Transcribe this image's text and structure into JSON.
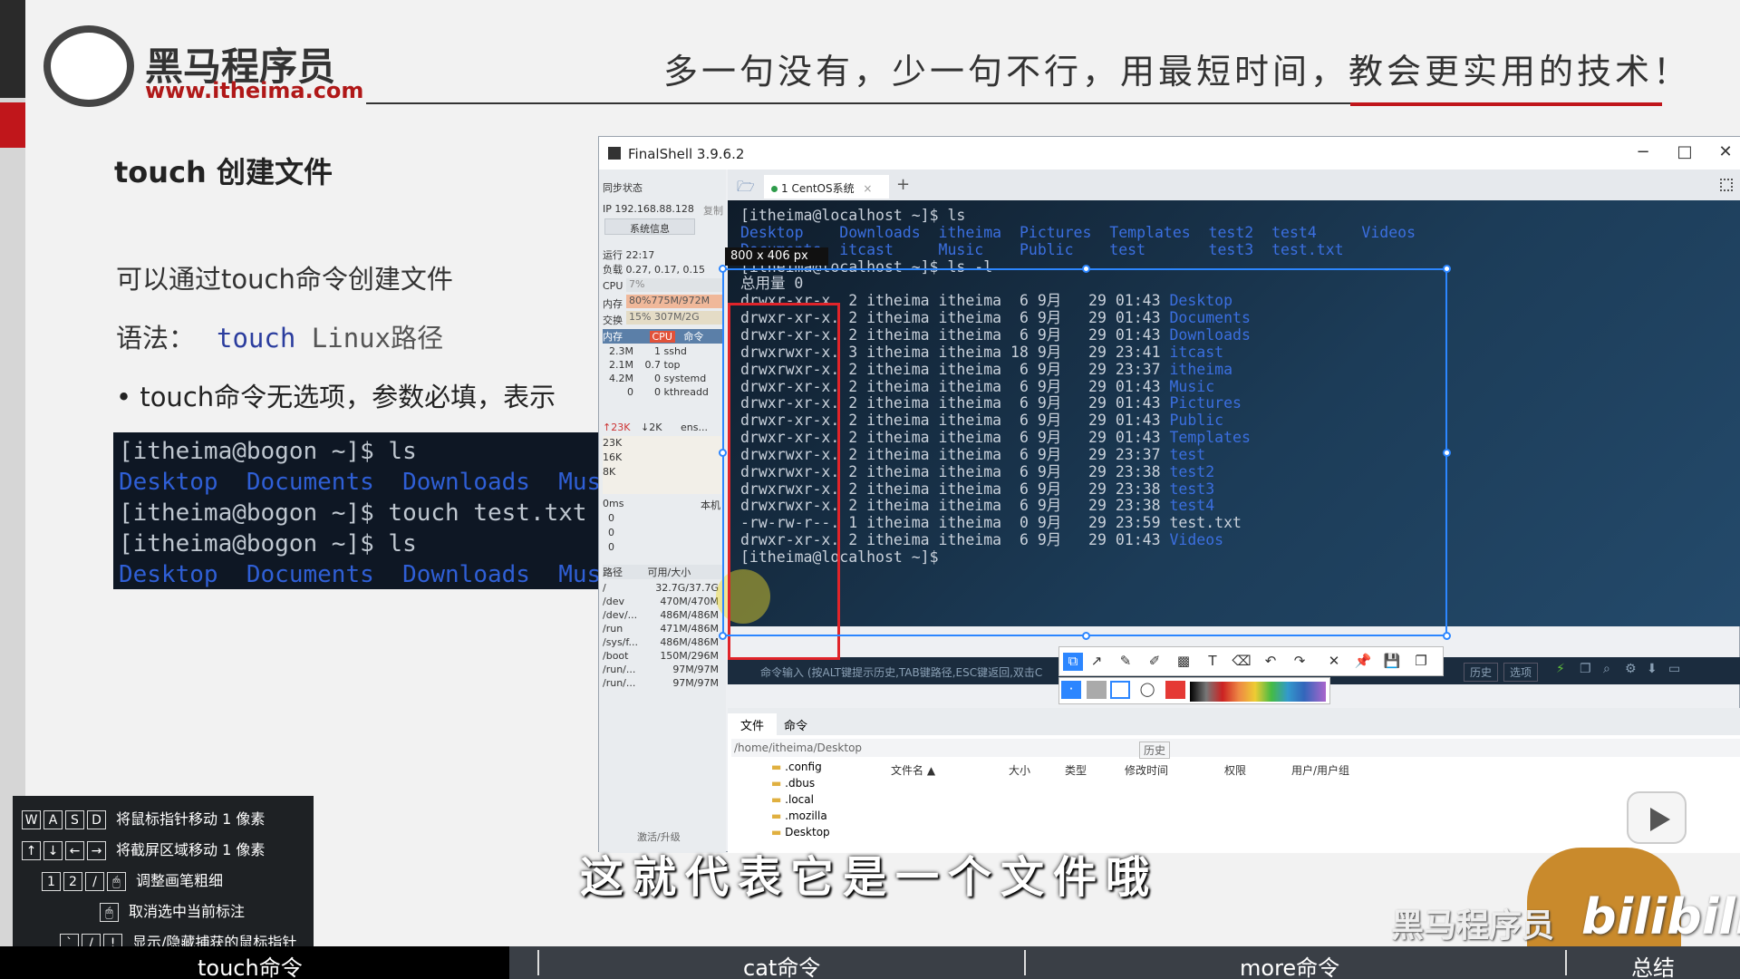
{
  "slide": {
    "logo_name": "黑马程序员",
    "logo_url": "www.itheima.com",
    "slogan": "多一句没有，少一句不行，用最短时间，教会更实用的技术！",
    "title": "touch 创建文件",
    "p1": "可以通过touch命令创建文件",
    "p2_label": "语法：",
    "p2_code": "touch",
    "p2_arg": " Linux路径",
    "p3": "•   touch命令无选项，参数必填，表示",
    "terminal": [
      {
        "text": "[itheima@bogon ~]$ ls",
        "type": "plain"
      },
      {
        "text": "Desktop  Documents  Downloads  Musi",
        "type": "blue"
      },
      {
        "text": "[itheima@bogon ~]$ touch test.txt",
        "type": "plain"
      },
      {
        "text": "[itheima@bogon ~]$ ls",
        "type": "plain"
      },
      {
        "text": "Desktop  Documents  Downloads  Musi",
        "type": "blue"
      }
    ]
  },
  "window": {
    "title": "FinalShell 3.9.6.2",
    "controls": {
      "minimize": "−",
      "maximize": "□",
      "close": "✕"
    },
    "side": {
      "sync": "同步状态",
      "ip": "IP 192.168.88.128",
      "copy": "复制",
      "sysinfo": "系统信息",
      "uptime": "运行 22:17",
      "load": "负载 0.27, 0.17, 0.15",
      "cpu": "CPU",
      "cpu_val": "7%",
      "mem": "内存",
      "mem_val": "80%775M/972M",
      "swap": "交换",
      "swap_val": "15%    307M/2G",
      "proc_header": [
        "内存",
        "CPU",
        "命令"
      ],
      "procs": [
        {
          "mem": "2.3M",
          "cpu": "1",
          "cmd": "sshd"
        },
        {
          "mem": "2.1M",
          "cpu": "0.7",
          "cmd": "top"
        },
        {
          "mem": "4.2M",
          "cpu": "0",
          "cmd": "systemd"
        },
        {
          "mem": "0",
          "cpu": "0",
          "cmd": "kthreadd"
        }
      ],
      "net_up": "23K",
      "net_down": "2K",
      "net_if": "ens...",
      "net_scale": [
        "23K",
        "16K",
        "8K"
      ],
      "latency_label": "0ms",
      "latency_host": "本机",
      "latency_vals": [
        "0",
        "0",
        "0"
      ],
      "disk_header": [
        "路径",
        "可用/大小"
      ],
      "disks": [
        {
          "path": "/",
          "size": "32.7G/37.7G"
        },
        {
          "path": "/dev",
          "size": "470M/470M"
        },
        {
          "path": "/dev/...",
          "size": "486M/486M"
        },
        {
          "path": "/run",
          "size": "471M/486M"
        },
        {
          "path": "/sys/f...",
          "size": "486M/486M"
        },
        {
          "path": "/boot",
          "size": "150M/296M"
        },
        {
          "path": "/run/...",
          "size": "97M/97M"
        },
        {
          "path": "/run/...",
          "size": "97M/97M"
        }
      ],
      "activate": "激活/升级"
    },
    "tab_label": "1 CentOS系统",
    "tab_close": "×",
    "tab_add": "+",
    "terminal_lines": [
      {
        "pre": "[itheima@localhost ~]$ ls",
        "name": "",
        "dir": false
      },
      {
        "pre": "Desktop    Downloads  itheima  Pictures  Templates  test2  test4     Videos",
        "name": "",
        "dir": true
      },
      {
        "pre": "Documents  itcast     Music    Public    test       test3  test.txt",
        "name": "",
        "dir": true
      },
      {
        "pre": "[itheima@localhost ~]$ ls -l",
        "name": "",
        "dir": false
      },
      {
        "pre": "总用量 0",
        "name": "",
        "dir": false
      },
      {
        "pre": "drwxr-xr-x. 2 itheima itheima  6 9月   29 01:43 ",
        "name": "Desktop",
        "dir": true
      },
      {
        "pre": "drwxr-xr-x. 2 itheima itheima  6 9月   29 01:43 ",
        "name": "Documents",
        "dir": true
      },
      {
        "pre": "drwxr-xr-x. 2 itheima itheima  6 9月   29 01:43 ",
        "name": "Downloads",
        "dir": true
      },
      {
        "pre": "drwxrwxr-x. 3 itheima itheima 18 9月   29 23:41 ",
        "name": "itcast",
        "dir": true
      },
      {
        "pre": "drwxrwxr-x. 2 itheima itheima  6 9月   29 23:37 ",
        "name": "itheima",
        "dir": true
      },
      {
        "pre": "drwxr-xr-x. 2 itheima itheima  6 9月   29 01:43 ",
        "name": "Music",
        "dir": true
      },
      {
        "pre": "drwxr-xr-x. 2 itheima itheima  6 9月   29 01:43 ",
        "name": "Pictures",
        "dir": true
      },
      {
        "pre": "drwxr-xr-x. 2 itheima itheima  6 9月   29 01:43 ",
        "name": "Public",
        "dir": true
      },
      {
        "pre": "drwxr-xr-x. 2 itheima itheima  6 9月   29 01:43 ",
        "name": "Templates",
        "dir": true
      },
      {
        "pre": "drwxrwxr-x. 2 itheima itheima  6 9月   29 23:37 ",
        "name": "test",
        "dir": true
      },
      {
        "pre": "drwxrwxr-x. 2 itheima itheima  6 9月   29 23:38 ",
        "name": "test2",
        "dir": true
      },
      {
        "pre": "drwxrwxr-x. 2 itheima itheima  6 9月   29 23:38 ",
        "name": "test3",
        "dir": true
      },
      {
        "pre": "drwxrwxr-x. 2 itheima itheima  6 9月   29 23:38 ",
        "name": "test4",
        "dir": true
      },
      {
        "pre": "-rw-rw-r--. 1 itheima itheima  0 9月   29 23:59 ",
        "name": "test.txt",
        "dir": false
      },
      {
        "pre": "drwxr-xr-x. 2 itheima itheima  6 9月   29 01:43 ",
        "name": "Videos",
        "dir": true
      },
      {
        "pre": "[itheima@localhost ~]$ ",
        "name": "",
        "dir": false
      }
    ],
    "size_tag": "800 x 406  px",
    "cmd_hint": "命令输入 (按ALT键提示历史,TAB键路径,ESC键返回,双击C",
    "history_btn": "历史",
    "options_btn": "选项",
    "bottom_tabs": [
      "文件",
      "命令"
    ],
    "path": "/home/itheima/Desktop",
    "path_history": "历史",
    "tree": [
      ".config",
      ".dbus",
      ".local",
      ".mozilla",
      "Desktop"
    ],
    "file_cols": [
      "文件名 ▲",
      "大小",
      "类型",
      "修改时间",
      "权限",
      "用户/用户组"
    ]
  },
  "keys": [
    {
      "keys": [
        "W",
        "A",
        "S",
        "D"
      ],
      "text": "将鼠标指针移动 1 像素"
    },
    {
      "keys": [
        "↑",
        "↓",
        "←",
        "→"
      ],
      "text": "将截屏区域移动 1 像素"
    },
    {
      "keys": [
        "1",
        "2",
        "/",
        "🖱"
      ],
      "text": "调整画笔粗细"
    },
    {
      "keys": [
        "🖱"
      ],
      "text": "取消选中当前标注"
    },
    {
      "keys": [
        "`",
        "/",
        "!"
      ],
      "text": "显示/隐藏捕获的鼠标指针"
    }
  ],
  "subtitle": "这就代表它是一个文件哦",
  "watermark": "黑马程序员",
  "bili": "bilibili",
  "chapters": [
    "touch命令",
    "cat命令",
    "more命令",
    "总结"
  ]
}
